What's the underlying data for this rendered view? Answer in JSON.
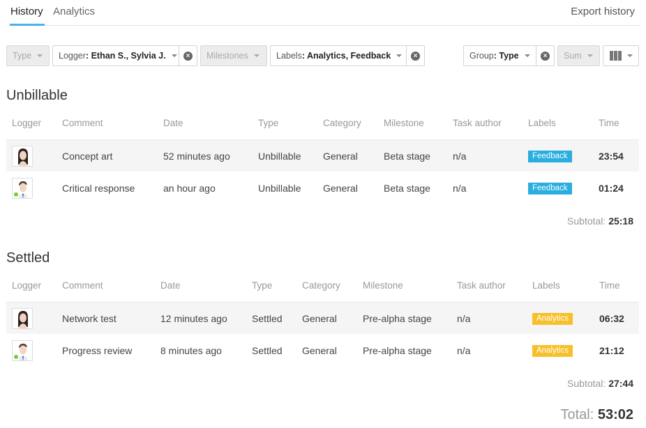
{
  "tabs": {
    "history": "History",
    "analytics": "Analytics",
    "export": "Export history"
  },
  "filters": {
    "type": "Type",
    "logger_label": "Logger",
    "logger_value": ": Ethan S., Sylvia J.",
    "milestones": "Milestones",
    "labels_label": "Labels",
    "labels_value": ": Analytics, Feedback",
    "group_label": "Group",
    "group_value": ": Type",
    "sum": "Sum"
  },
  "columns": {
    "logger": "Logger",
    "comment": "Comment",
    "date": "Date",
    "type": "Type",
    "category": "Category",
    "milestone": "Milestone",
    "task_author": "Task author",
    "labels": "Labels",
    "time": "Time"
  },
  "sections": [
    {
      "title": "Unbillable",
      "rows": [
        {
          "comment": "Concept art",
          "date": "52 minutes ago",
          "type": "Unbillable",
          "category": "General",
          "milestone": "Beta stage",
          "author": "n/a",
          "label": "Feedback",
          "time": "23:54"
        },
        {
          "comment": "Critical response",
          "date": "an hour ago",
          "type": "Unbillable",
          "category": "General",
          "milestone": "Beta stage",
          "author": "n/a",
          "label": "Feedback",
          "time": "01:24"
        }
      ],
      "subtotal_label": "Subtotal:",
      "subtotal": "25:18"
    },
    {
      "title": "Settled",
      "rows": [
        {
          "comment": "Network test",
          "date": "12 minutes ago",
          "type": "Settled",
          "category": "General",
          "milestone": "Pre-alpha stage",
          "author": "n/a",
          "label": "Analytics",
          "time": "06:32"
        },
        {
          "comment": "Progress review",
          "date": "8 minutes ago",
          "type": "Settled",
          "category": "General",
          "milestone": "Pre-alpha stage",
          "author": "n/a",
          "label": "Analytics",
          "time": "21:12"
        }
      ],
      "subtotal_label": "Subtotal:",
      "subtotal": "27:44"
    }
  ],
  "total_label": "Total:",
  "total": "53:02",
  "colors": {
    "accent": "#45b3e8",
    "feedback_badge": "#29aee0",
    "analytics_badge": "#f7c02a",
    "online": "#7cc83a"
  }
}
